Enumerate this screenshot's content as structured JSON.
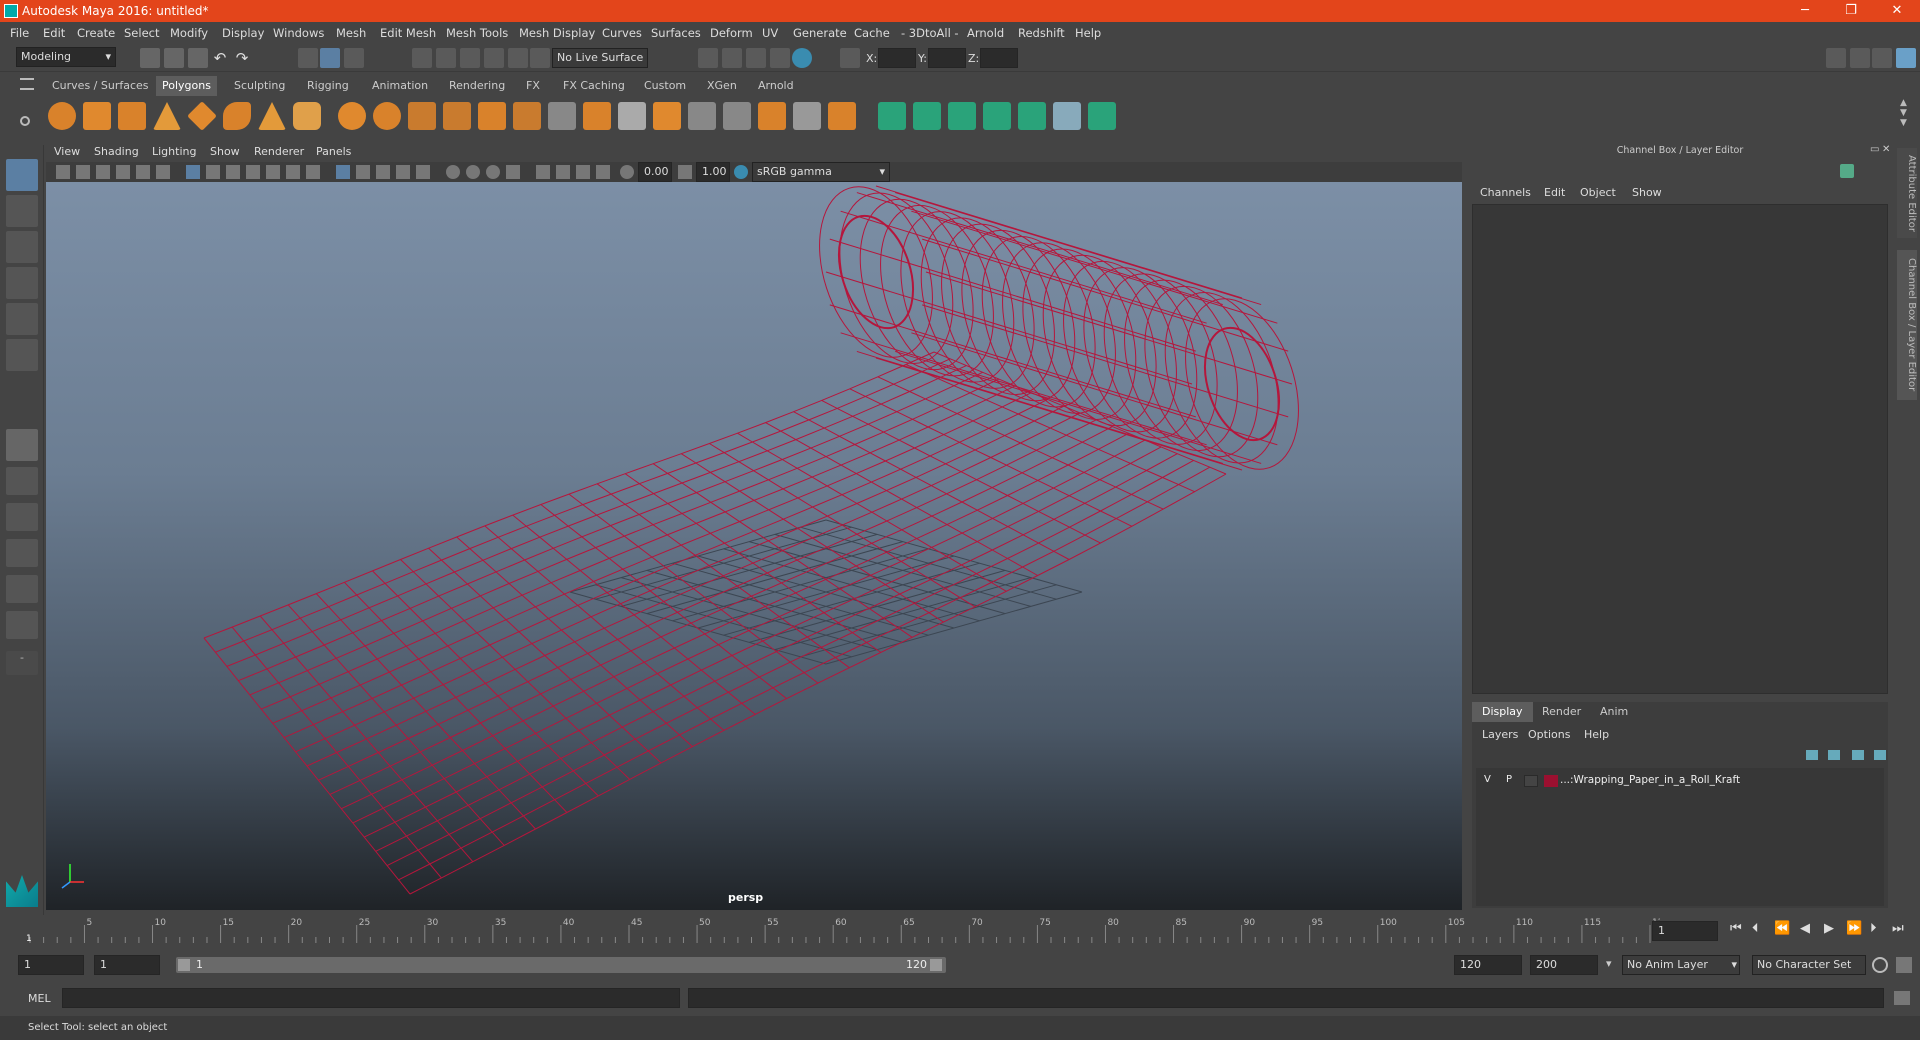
{
  "window": {
    "title": "Autodesk Maya 2016: untitled*"
  },
  "menu": [
    "File",
    "Edit",
    "Create",
    "Select",
    "Modify",
    "Display",
    "Windows",
    "Mesh",
    "Edit Mesh",
    "Mesh Tools",
    "Mesh Display",
    "Curves",
    "Surfaces",
    "Deform",
    "UV",
    "Generate",
    "Cache",
    "- 3DtoAll -",
    "Arnold",
    "Redshift",
    "Help"
  ],
  "status": {
    "mode": "Modeling",
    "live_surface": "No Live Surface",
    "x_label": "X:",
    "y_label": "Y:",
    "z_label": "Z:"
  },
  "shelf_tabs": [
    "Curves / Surfaces",
    "Polygons",
    "Sculpting",
    "Rigging",
    "Animation",
    "Rendering",
    "FX",
    "FX Caching",
    "Custom",
    "XGen",
    "Arnold"
  ],
  "shelf_active": "Polygons",
  "viewport": {
    "menu": [
      "View",
      "Shading",
      "Lighting",
      "Show",
      "Renderer",
      "Panels"
    ],
    "exposure": "0.00",
    "gamma": "1.00",
    "colorspace": "sRGB gamma",
    "camera": "persp",
    "wire_color": "#b5163c"
  },
  "channel_box": {
    "title": "Channel Box / Layer Editor",
    "menu": [
      "Channels",
      "Edit",
      "Object",
      "Show"
    ]
  },
  "layer_editor": {
    "tabs": [
      "Display",
      "Render",
      "Anim"
    ],
    "active_tab": "Display",
    "menu": [
      "Layers",
      "Options",
      "Help"
    ],
    "layers": [
      {
        "v": "V",
        "p": "P",
        "name": "...:Wrapping_Paper_in_a_Roll_Kraft",
        "color": "#9b1030"
      }
    ]
  },
  "side_tabs": [
    "Attribute Editor",
    "Channel Box / Layer Editor"
  ],
  "timeline": {
    "ticks": [
      "5",
      "10",
      "15",
      "20",
      "25",
      "30",
      "35",
      "40",
      "45",
      "50",
      "55",
      "60",
      "65",
      "70",
      "75",
      "80",
      "85",
      "90",
      "95",
      "100",
      "105",
      "110",
      "115",
      "120"
    ],
    "start_label": "1",
    "current": "1"
  },
  "range": {
    "start": "1",
    "playback_start": "1",
    "slider_start": "1",
    "slider_end": "120",
    "playback_end": "120",
    "end": "200",
    "anim_layer": "No Anim Layer",
    "char_set": "No Character Set"
  },
  "command": {
    "label": "MEL"
  },
  "help": {
    "text": "Select Tool: select an object"
  }
}
